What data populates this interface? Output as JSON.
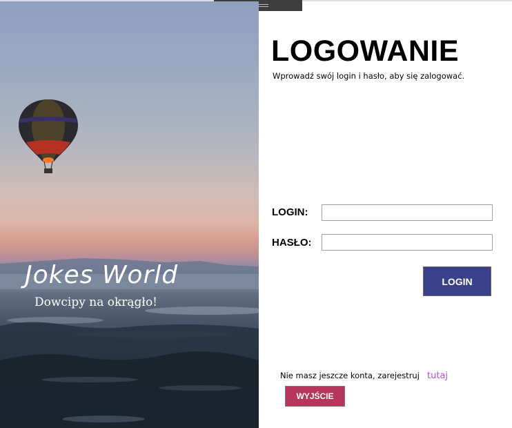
{
  "branding": {
    "title": "Jokes World",
    "subtitle": "Dowcipy na okrągło!"
  },
  "login_form": {
    "title": "LOGOWANIE",
    "subtitle": "Wprowadź swój login i hasło, aby się zalogować.",
    "login_label": "LOGIN:",
    "login_value": "",
    "password_label": "HASŁO:",
    "password_value": "",
    "submit_label": "LOGIN"
  },
  "register": {
    "text": "Nie masz jeszcze konta, zarejestruj",
    "link": "tutaj"
  },
  "exit_button": "WYJŚCIE",
  "colors": {
    "login_button": "#39418a",
    "exit_button": "#b7345c",
    "link": "#b84fd6"
  },
  "icons": {
    "window_grip": "grip-lines-icon",
    "balloon": "hot-air-balloon-icon"
  }
}
